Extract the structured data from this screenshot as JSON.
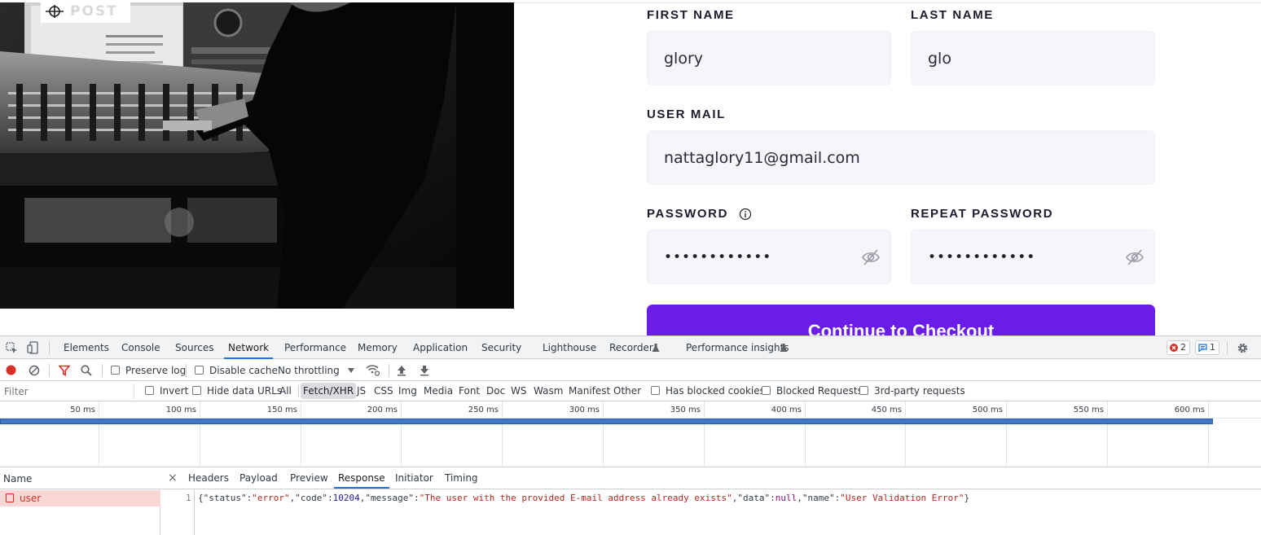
{
  "site": {
    "logo_text": "POST",
    "form": {
      "first_name": {
        "label": "FIRST NAME",
        "value": "glory"
      },
      "last_name": {
        "label": "LAST NAME",
        "value": "glo"
      },
      "email": {
        "label": "USER MAIL",
        "value": "nattaglory11@gmail.com"
      },
      "password": {
        "label": "PASSWORD",
        "value": "••••••••••••"
      },
      "repeat_password": {
        "label": "REPEAT PASSWORD",
        "value": "••••••••••••"
      },
      "submit_label": "Continue to Checkout"
    },
    "colors": {
      "accent": "#6b1de8",
      "field_bg": "#f5f6fb"
    }
  },
  "devtools": {
    "tabs": [
      "Elements",
      "Console",
      "Sources",
      "Network",
      "Performance",
      "Memory",
      "Application",
      "Security",
      "Lighthouse",
      "Recorder",
      "Performance insights"
    ],
    "active_tab": "Network",
    "error_count": "2",
    "message_count": "1",
    "toolbar": {
      "preserve_log": "Preserve log",
      "disable_cache": "Disable cache",
      "throttling": "No throttling"
    },
    "filter": {
      "placeholder": "Filter",
      "invert": "Invert",
      "hide_data_urls": "Hide data URLs",
      "types": [
        "All",
        "Fetch/XHR",
        "JS",
        "CSS",
        "Img",
        "Media",
        "Font",
        "Doc",
        "WS",
        "Wasm",
        "Manifest",
        "Other"
      ],
      "active_type": "Fetch/XHR",
      "has_blocked_cookies": "Has blocked cookies",
      "blocked_requests": "Blocked Requests",
      "third_party": "3rd-party requests"
    },
    "timeline_ticks": [
      "50 ms",
      "100 ms",
      "150 ms",
      "200 ms",
      "250 ms",
      "300 ms",
      "350 ms",
      "400 ms",
      "450 ms",
      "500 ms",
      "550 ms",
      "600 ms"
    ],
    "requests": {
      "column_name": "Name",
      "items": [
        {
          "name": "user",
          "status": "error"
        }
      ]
    },
    "detail": {
      "close": "×",
      "tabs": [
        "Headers",
        "Payload",
        "Preview",
        "Response",
        "Initiator",
        "Timing"
      ],
      "active_tab": "Response",
      "line_number": "1",
      "response": {
        "status": "error",
        "code": 10204,
        "message": "The user with the provided E-mail address already exists",
        "data": "null",
        "name": "User Validation Error"
      }
    }
  }
}
